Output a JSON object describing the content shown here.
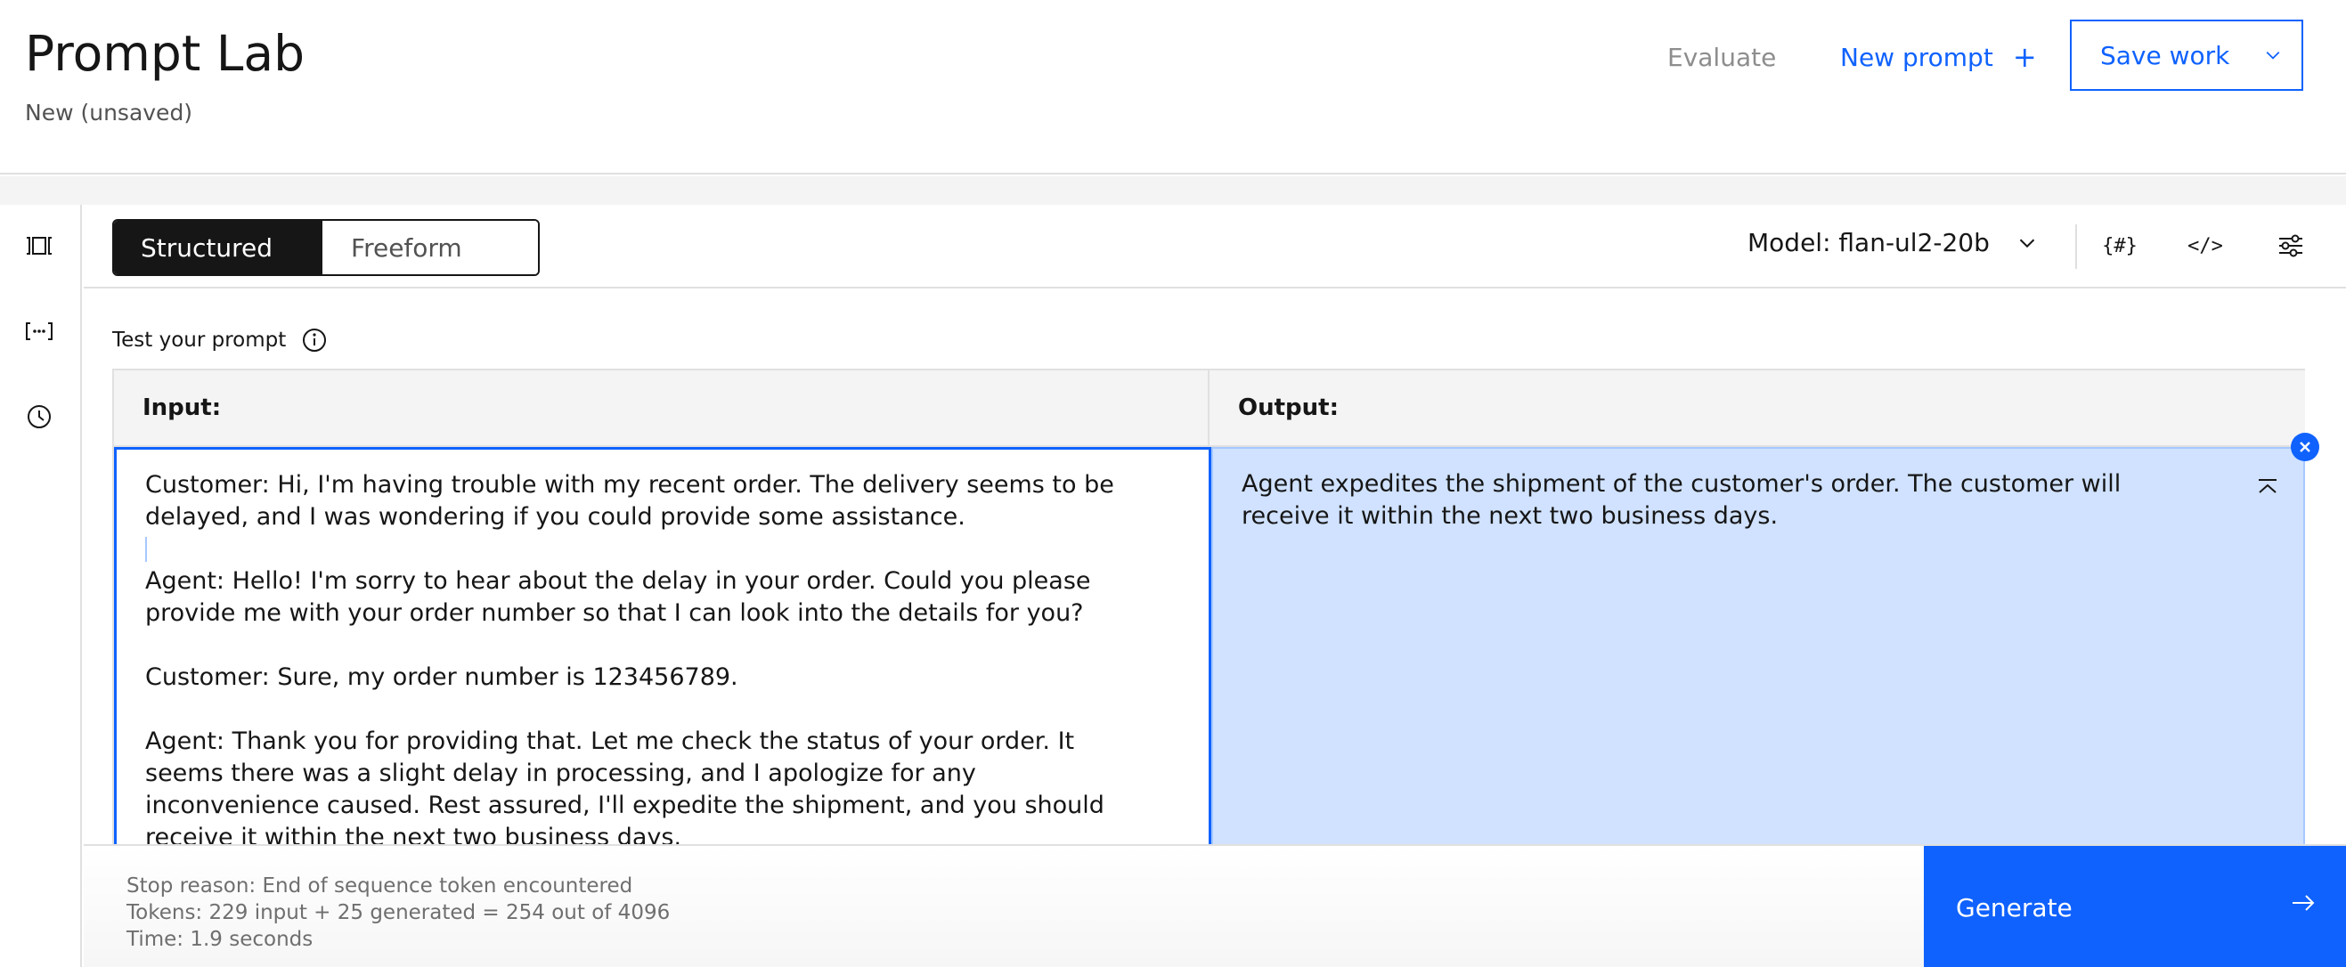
{
  "header": {
    "title": "Prompt Lab",
    "subtitle": "New (unsaved)",
    "evaluate_label": "Evaluate",
    "new_prompt_label": "New prompt",
    "new_prompt_icon": "plus-icon",
    "save_label": "Save work",
    "save_icon": "chevron-down-icon"
  },
  "rail": {
    "items": [
      {
        "icon": "sample-prompts-icon"
      },
      {
        "icon": "variables-icon"
      },
      {
        "icon": "history-icon"
      }
    ]
  },
  "toolbar": {
    "modes": [
      "Structured",
      "Freeform"
    ],
    "selected_mode": "Structured",
    "model_label": "Model: flan-ul2-20b",
    "icons": [
      "token-icon",
      "code-icon",
      "settings-sliders-icon"
    ]
  },
  "test": {
    "label": "Test your prompt",
    "info_icon": "info-icon"
  },
  "panels": {
    "input_header": "Input:",
    "output_header": "Output:",
    "input_paragraphs": [
      "Customer: Hi, I'm having trouble with my recent order. The delivery seems to be delayed, and I was wondering if you could provide some assistance.",
      "Agent: Hello! I'm sorry to hear about the delay in your order. Could you please provide me with your order number so that I can look into the details for you?",
      "Customer: Sure, my order number is 123456789.",
      "Agent: Thank you for providing that. Let me check the status of your order. It seems there was a slight delay in processing, and I apologize for any inconvenience caused. Rest assured, I'll expedite the shipment, and you should receive it within the next two business days."
    ],
    "output_text": "Agent expedites the shipment of the customer's order. The customer will receive it within the next two business days."
  },
  "footer": {
    "stop_reason": "Stop reason: End of sequence token encountered",
    "tokens": "Tokens: 229 input + 25 generated = 254 out of 4096",
    "time": "Time: 1.9 seconds",
    "generate_label": "Generate"
  },
  "colors": {
    "accent": "#0f62fe",
    "output_bg": "#d0e2ff",
    "dark": "#161616"
  }
}
